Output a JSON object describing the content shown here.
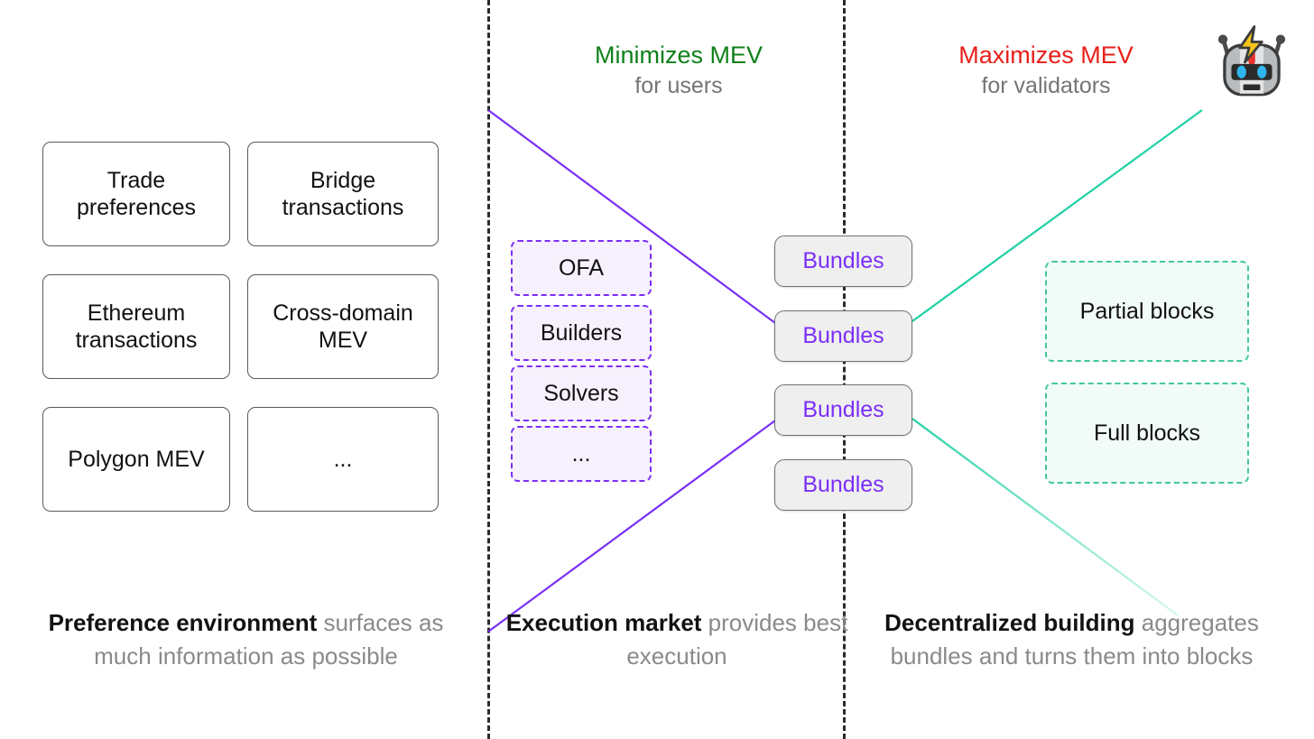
{
  "diagram": {
    "title_hidden": "",
    "colors": {
      "minimizes": "#10801a",
      "maximizes": "#e8201a",
      "bundles_purple": "#7b2ff7",
      "execution_dash": "#7b2ff7",
      "blocks_dash": "#43c6a0",
      "subtext_gray": "#757575",
      "divider": "#2b2b2b"
    },
    "headings": [
      {
        "main": "Minimizes MEV",
        "sub": "for users"
      },
      {
        "main": "Maximizes MEV",
        "sub": "for validators"
      }
    ],
    "preference_boxes": [
      {
        "label": "Trade\npreferences"
      },
      {
        "label": "Bridge\ntransactions"
      },
      {
        "label": "Ethereum\ntransactions"
      },
      {
        "label": "Cross-domain\nMEV"
      },
      {
        "label": "Polygon MEV"
      },
      {
        "label": "..."
      }
    ],
    "execution_boxes": [
      {
        "label": "OFA"
      },
      {
        "label": "Builders"
      },
      {
        "label": "Solvers"
      },
      {
        "label": "..."
      }
    ],
    "bundle_boxes": [
      {
        "label": "Bundles"
      },
      {
        "label": "Bundles"
      },
      {
        "label": "Bundles"
      },
      {
        "label": "Bundles"
      }
    ],
    "block_boxes": [
      {
        "label": "Partial blocks"
      },
      {
        "label": "Full blocks"
      }
    ],
    "captions": [
      {
        "strong": "Preference environment",
        "rest": " surfaces as much information as possible"
      },
      {
        "strong": "Execution market",
        "rest": " provides best execution"
      },
      {
        "strong": "Decentralized building",
        "rest": " aggregates bundles and turns them into blocks"
      }
    ],
    "robot": {
      "icon": "robot-lightning-icon"
    }
  }
}
